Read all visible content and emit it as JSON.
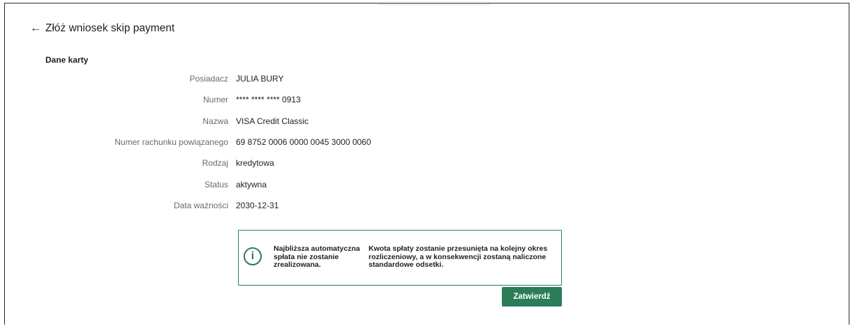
{
  "header": {
    "back_arrow": "←",
    "title": "Złóż wniosek skip payment"
  },
  "section": {
    "title": "Dane karty"
  },
  "card_details": [
    {
      "label": "Posiadacz",
      "value": "JULIA BURY"
    },
    {
      "label": "Numer",
      "value": "**** **** **** 0913"
    },
    {
      "label": "Nazwa",
      "value": "VISA Credit Classic"
    },
    {
      "label": "Numer rachunku powiązanego",
      "value": "69 8752 0006 0000 0045 3000 0060"
    },
    {
      "label": "Rodzaj",
      "value": "kredytowa"
    },
    {
      "label": "Status",
      "value": "aktywna"
    },
    {
      "label": "Data ważności",
      "value": "2030-12-31"
    }
  ],
  "info": {
    "icon": "info-icon",
    "icon_glyph": "i",
    "left_text": "Najbliższa automatyczna spłata nie zostanie zrealizowana.",
    "right_text": "Kwota spłaty zostanie przesunięta na kolejny okres rozliczeniowy, a w konsekwencji zostaną naliczone standardowe odsetki."
  },
  "actions": {
    "confirm_label": "Zatwierdź"
  },
  "colors": {
    "accent": "#2a7d57",
    "label_gray": "#6a6a6a",
    "text": "#1f1f1f"
  }
}
